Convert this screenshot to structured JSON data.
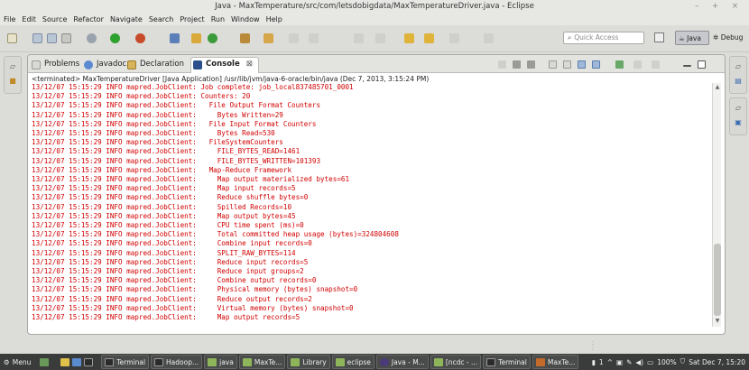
{
  "window": {
    "title": "Java - MaxTemperature/src/com/letsdobigdata/MaxTemperatureDriver.java - Eclipse",
    "controls": "– + ×"
  },
  "menu": [
    "File",
    "Edit",
    "Source",
    "Refactor",
    "Navigate",
    "Search",
    "Project",
    "Run",
    "Window",
    "Help"
  ],
  "toolbar": {
    "quick_access_placeholder": "Quick Access",
    "perspective_java": "Java",
    "perspective_debug": "Debug"
  },
  "view": {
    "tabs": [
      {
        "label": "Problems",
        "icon": "problems-icon"
      },
      {
        "label": "Javadoc",
        "icon": "javadoc-icon"
      },
      {
        "label": "Declaration",
        "icon": "declaration-icon"
      },
      {
        "label": "Console",
        "icon": "console-icon",
        "close": "⊠"
      }
    ],
    "console_header": "<terminated> MaxTemperatureDriver [Java Application] /usr/lib/jvm/java-6-oracle/bin/java (Dec 7, 2013, 3:15:24 PM)",
    "lines": [
      "13/12/07 15:15:29 INFO mapred.JobClient: Job complete: job_local837485701_0001",
      "13/12/07 15:15:29 INFO mapred.JobClient: Counters: 20",
      "13/12/07 15:15:29 INFO mapred.JobClient:   File Output Format Counters",
      "13/12/07 15:15:29 INFO mapred.JobClient:     Bytes Written=29",
      "13/12/07 15:15:29 INFO mapred.JobClient:   File Input Format Counters",
      "13/12/07 15:15:29 INFO mapred.JobClient:     Bytes Read=530",
      "13/12/07 15:15:29 INFO mapred.JobClient:   FileSystemCounters",
      "13/12/07 15:15:29 INFO mapred.JobClient:     FILE_BYTES_READ=1461",
      "13/12/07 15:15:29 INFO mapred.JobClient:     FILE_BYTES_WRITTEN=101393",
      "13/12/07 15:15:29 INFO mapred.JobClient:   Map-Reduce Framework",
      "13/12/07 15:15:29 INFO mapred.JobClient:     Map output materialized bytes=61",
      "13/12/07 15:15:29 INFO mapred.JobClient:     Map input records=5",
      "13/12/07 15:15:29 INFO mapred.JobClient:     Reduce shuffle bytes=0",
      "13/12/07 15:15:29 INFO mapred.JobClient:     Spilled Records=10",
      "13/12/07 15:15:29 INFO mapred.JobClient:     Map output bytes=45",
      "13/12/07 15:15:29 INFO mapred.JobClient:     CPU time spent (ms)=0",
      "13/12/07 15:15:29 INFO mapred.JobClient:     Total committed heap usage (bytes)=324804608",
      "13/12/07 15:15:29 INFO mapred.JobClient:     Combine input records=0",
      "13/12/07 15:15:29 INFO mapred.JobClient:     SPLIT_RAW_BYTES=114",
      "13/12/07 15:15:29 INFO mapred.JobClient:     Reduce input records=5",
      "13/12/07 15:15:29 INFO mapred.JobClient:     Reduce input groups=2",
      "13/12/07 15:15:29 INFO mapred.JobClient:     Combine output records=0",
      "13/12/07 15:15:29 INFO mapred.JobClient:     Physical memory (bytes) snapshot=0",
      "13/12/07 15:15:29 INFO mapred.JobClient:     Reduce output records=2",
      "13/12/07 15:15:29 INFO mapred.JobClient:     Virtual memory (bytes) snapshot=0",
      "13/12/07 15:15:29 INFO mapred.JobClient:     Map output records=5"
    ]
  },
  "taskbar": {
    "menu": "Menu",
    "items": [
      {
        "label": "Terminal",
        "icon": "terminal-icon",
        "color": "#2b2b2b"
      },
      {
        "label": "Hadoop...",
        "icon": "terminal-icon",
        "color": "#2b2b2b"
      },
      {
        "label": "java",
        "icon": "folder-icon",
        "color": "#8fb55b"
      },
      {
        "label": "MaxTe...",
        "icon": "folder-icon",
        "color": "#8fb55b"
      },
      {
        "label": "Library",
        "icon": "folder-icon",
        "color": "#8fb55b"
      },
      {
        "label": "eclipse",
        "icon": "folder-icon",
        "color": "#8fb55b"
      },
      {
        "label": "Java - M...",
        "icon": "eclipse-icon",
        "color": "#4b3a7a"
      },
      {
        "label": "[ncdc - ...",
        "icon": "folder-icon",
        "color": "#8fb55b"
      },
      {
        "label": "Terminal",
        "icon": "terminal-icon",
        "color": "#2b2b2b"
      },
      {
        "label": "MaxTe...",
        "icon": "editor-icon",
        "color": "#c46a2a"
      }
    ],
    "tray_count": "1",
    "battery": "100%",
    "clock": "Sat Dec  7, 15:20"
  }
}
